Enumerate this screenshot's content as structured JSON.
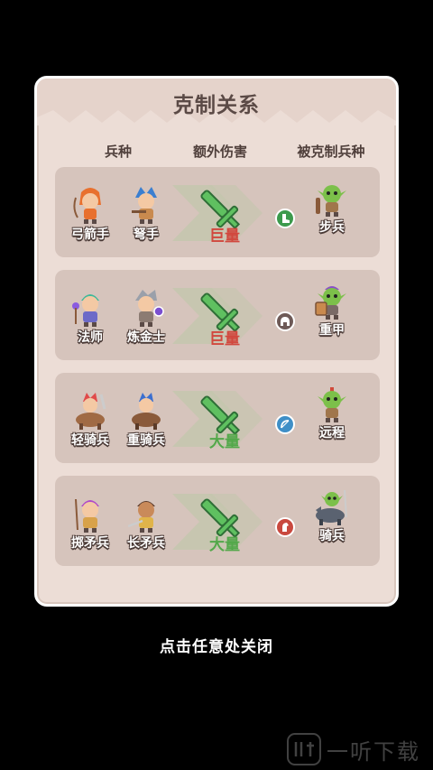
{
  "dialog": {
    "title": "克制关系",
    "columns": {
      "unit_type": "兵种",
      "extra_damage": "额外伤害",
      "countered_unit": "被克制兵种"
    }
  },
  "rows": [
    {
      "attackers": [
        "弓箭手",
        "弩手"
      ],
      "damage": "巨量",
      "damage_level": "huge",
      "countered": "步兵",
      "badge_icon": "boot-icon",
      "badge_color": "#3c9a4c"
    },
    {
      "attackers": [
        "法师",
        "炼金士"
      ],
      "damage": "巨量",
      "damage_level": "huge",
      "countered": "重甲",
      "badge_icon": "helmet-icon",
      "badge_color": "#6e5a57"
    },
    {
      "attackers": [
        "轻骑兵",
        "重骑兵"
      ],
      "damage": "大量",
      "damage_level": "big",
      "countered": "远程",
      "badge_icon": "bow-icon",
      "badge_color": "#3f8fc7"
    },
    {
      "attackers": [
        "掷矛兵",
        "长矛兵"
      ],
      "damage": "大量",
      "damage_level": "big",
      "countered": "骑兵",
      "badge_icon": "horse-icon",
      "badge_color": "#c9493f"
    }
  ],
  "footer": {
    "close_hint": "点击任意处关闭"
  },
  "watermark": {
    "text": "一听下载"
  },
  "colors": {
    "huge": "#d1483e",
    "big": "#53a84a",
    "panel": "#ecddd6",
    "row": "#d6c4bc"
  }
}
